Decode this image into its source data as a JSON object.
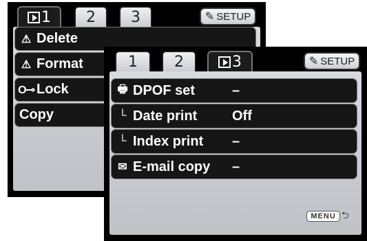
{
  "back_screen": {
    "tabs": [
      {
        "label": "1",
        "active": true,
        "icon": "playback-icon"
      },
      {
        "label": "2",
        "active": false
      },
      {
        "label": "3",
        "active": false
      }
    ],
    "setup_label": "SETUP",
    "items": [
      {
        "label": "Delete",
        "icon": "warning-icon"
      },
      {
        "label": "Format",
        "icon": "warning-icon"
      },
      {
        "label": "Lock",
        "icon": "key-icon"
      },
      {
        "label": "Copy",
        "icon": ""
      }
    ]
  },
  "front_screen": {
    "tabs": [
      {
        "label": "1",
        "active": false
      },
      {
        "label": "2",
        "active": false
      },
      {
        "label": "3",
        "active": true,
        "icon": "playback-icon"
      }
    ],
    "setup_label": "SETUP",
    "items": [
      {
        "label": "DPOF set",
        "value": "–",
        "icon": "printer-icon"
      },
      {
        "label": "Date print",
        "value": "Off",
        "icon": "sub-item-corner-icon"
      },
      {
        "label": "Index print",
        "value": "–",
        "icon": "sub-item-corner-icon"
      },
      {
        "label": "E-mail copy",
        "value": "–",
        "icon": "envelope-icon"
      }
    ],
    "menu_label": "MENU"
  },
  "icons": {
    "warning": "⚠",
    "key": "O⊸",
    "printer": "🖶",
    "corner": "└",
    "envelope": "✉",
    "return": "⮌",
    "wrench": "✎"
  }
}
